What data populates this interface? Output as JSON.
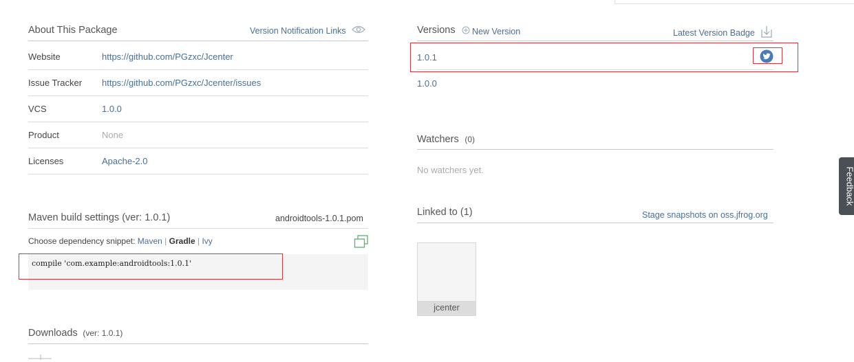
{
  "about": {
    "title": "About This Package",
    "notification_link": "Version Notification Links",
    "rows": [
      {
        "label": "Website",
        "value": "https://github.com/PGzxc/Jcenter"
      },
      {
        "label": "Issue Tracker",
        "value": "https://github.com/PGzxc/Jcenter/issues"
      },
      {
        "label": "VCS",
        "value": "1.0.0"
      },
      {
        "label": "Product",
        "value": "None"
      },
      {
        "label": "Licenses",
        "value": "Apache-2.0"
      }
    ]
  },
  "maven": {
    "title": "Maven build settings (ver: 1.0.1)",
    "pom": "androidtools-1.0.1.pom",
    "choose_label": "Choose dependency snippet:",
    "options": [
      "Maven",
      "Gradle",
      "Ivy"
    ],
    "separator": "|",
    "snippet": "compile 'com.example:androidtools:1.0.1'"
  },
  "downloads": {
    "title": "Downloads",
    "ver": "(ver: 1.0.1)"
  },
  "versions": {
    "title": "Versions",
    "new_version": "New Version",
    "latest_badge": "Latest Version Badge",
    "items": [
      "1.0.1",
      "1.0.0"
    ]
  },
  "watchers": {
    "title": "Watchers",
    "count": "(0)",
    "empty": "No watchers yet."
  },
  "linked": {
    "title": "Linked to (1)",
    "stage": "Stage snapshots on oss.jfrog.org",
    "repo": "jcenter"
  },
  "feedback": {
    "label": "Feedback"
  },
  "colors": {
    "accent_link": "#4a6f95",
    "highlight_box": "#d9343c",
    "twitter": "#4a7bb5"
  }
}
